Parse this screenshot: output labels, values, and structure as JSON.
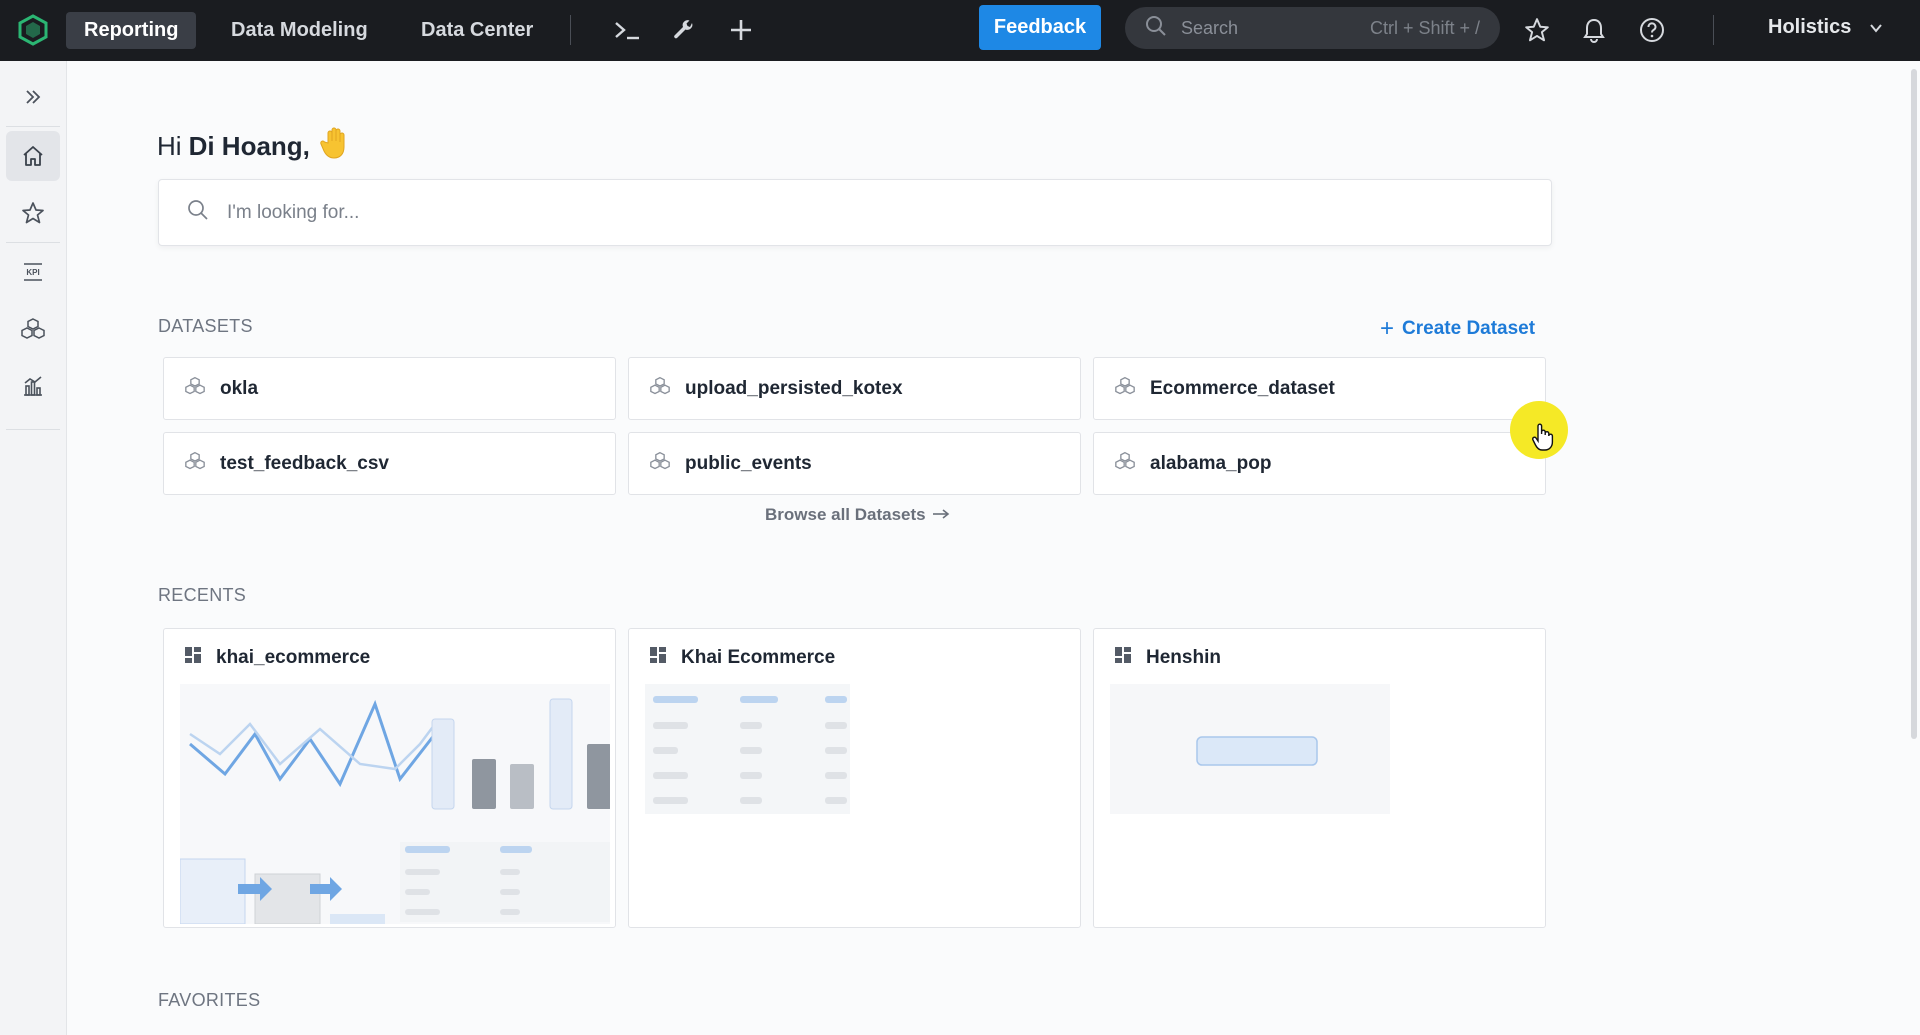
{
  "topbar": {
    "nav": [
      "Reporting",
      "Data Modeling",
      "Data Center"
    ],
    "feedback_label": "Feedback",
    "search": {
      "placeholder": "Search",
      "shortcut": "Ctrl + Shift + /"
    },
    "org_name": "Holistics",
    "icons": [
      "terminal-icon",
      "wrench-icon",
      "plus-icon",
      "star-icon",
      "bell-icon",
      "help-icon",
      "chevron-down-icon"
    ]
  },
  "sidebar": {
    "items": [
      "expand-icon",
      "home-icon",
      "star-icon",
      "kpi-icon",
      "dataset-icon",
      "chart-icon"
    ]
  },
  "greeting": {
    "prefix": "Hi",
    "name": "Di Hoang,",
    "emoji": "wave"
  },
  "main_search": {
    "placeholder": "I'm looking for..."
  },
  "datasets": {
    "title": "DATASETS",
    "create_label": "Create Dataset",
    "items": [
      "okla",
      "upload_persisted_kotex",
      "Ecommerce_dataset",
      "test_feedback_csv",
      "public_events",
      "alabama_pop"
    ],
    "browse_label": "Browse all Datasets"
  },
  "recents": {
    "title": "RECENTS",
    "items": [
      "khai_ecommerce",
      "Khai Ecommerce",
      "Henshin"
    ]
  },
  "favorites": {
    "title": "FAVORITES"
  },
  "colors": {
    "topbar": "#1a1c20",
    "accent": "#1e88e5",
    "cursor_highlight": "#f5e926"
  }
}
